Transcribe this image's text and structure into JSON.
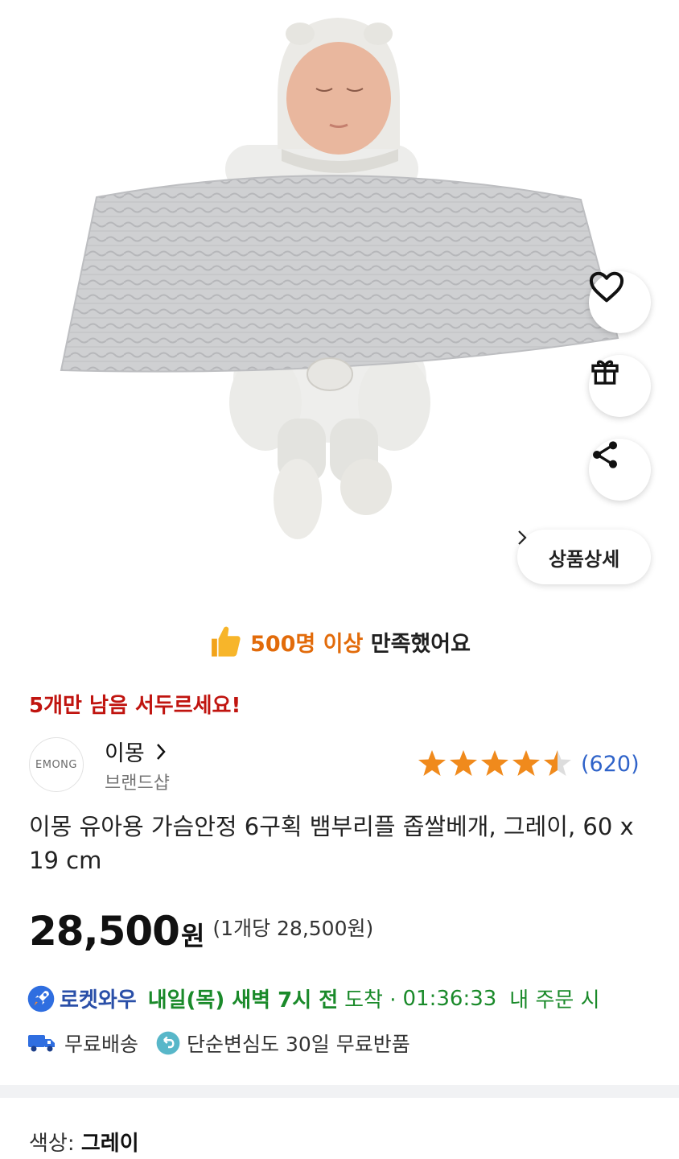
{
  "product_image": {
    "alt": ""
  },
  "actions": {
    "like_icon": "heart-icon",
    "gift_icon": "gift-icon",
    "share_icon": "share-icon",
    "detail_label": "상품상세"
  },
  "satisfaction": {
    "accent": "500명 이상",
    "rest": "만족했어요"
  },
  "urgency": "5개만 남음 서두르세요!",
  "brand": {
    "logo_text": "EMONG",
    "name": "이몽",
    "sub": "브랜드샵"
  },
  "rating": {
    "stars": 4.5,
    "count": "(620)"
  },
  "product": {
    "title": "이몽 유아용 가슴안정 6구획 뱀부리플 좁쌀베개, 그레이, 60 x 19 cm",
    "price": "28,500",
    "currency": "원",
    "unit_price": "(1개당 28,500원)"
  },
  "delivery": {
    "badge": "로켓와우",
    "eta": "내일(목) 새벽 7시 전",
    "arrive": "도착 ·",
    "timer": "01:36:33",
    "when": "내 주문 시"
  },
  "shipping": {
    "free_shipping": "무료배송",
    "free_return": "단순변심도 30일 무료반품"
  },
  "option": {
    "label": "색상:",
    "value": "그레이"
  },
  "colors": {
    "accent_orange": "#e26b0a",
    "urgent_red": "#c0140f",
    "rating_star": "#f08a1c",
    "link_blue": "#2f63c9",
    "rocket_blue": "#2a4fa8",
    "delivery_green": "#1a8a2a"
  }
}
